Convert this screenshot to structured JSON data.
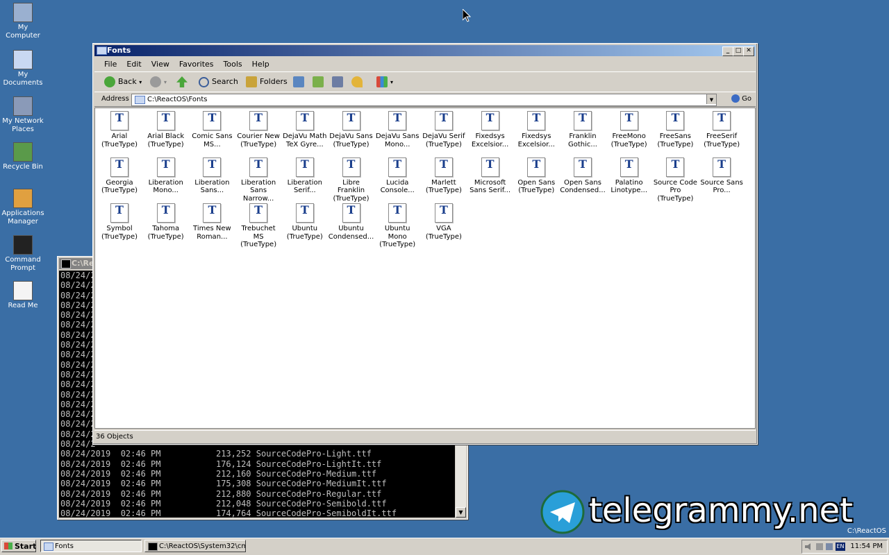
{
  "desktop": {
    "icons": [
      {
        "label": "My Computer",
        "icon": "computer-icon"
      },
      {
        "label": "My Documents",
        "icon": "documents-folder-icon"
      },
      {
        "label": "My Network Places",
        "icon": "network-icon"
      },
      {
        "label": "Recycle Bin",
        "icon": "recycle-bin-icon"
      },
      {
        "label": "Applications Manager",
        "icon": "applications-manager-icon"
      },
      {
        "label": "Command Prompt",
        "icon": "command-prompt-icon"
      },
      {
        "label": "Read Me",
        "icon": "document-icon"
      }
    ]
  },
  "console": {
    "title": "C:\\Reac",
    "lines": [
      "08/24/2",
      "08/24/2",
      "08/24/2",
      "08/24/2",
      "08/24/2",
      "08/24/2",
      "08/24/2",
      "08/24/2",
      "08/24/2",
      "08/24/2",
      "08/24/2",
      "08/24/2",
      "08/24/2",
      "08/24/2",
      "08/24/2",
      "08/24/2",
      "08/24/2",
      "08/24/2",
      "08/24/2019  02:46 PM           213,252 SourceCodePro-Light.ttf",
      "08/24/2019  02:46 PM           176,124 SourceCodePro-LightIt.ttf",
      "08/24/2019  02:46 PM           212,160 SourceCodePro-Medium.ttf",
      "08/24/2019  02:46 PM           175,308 SourceCodePro-MediumIt.ttf",
      "08/24/2019  02:46 PM           212,880 SourceCodePro-Regular.ttf",
      "08/24/2019  02:46 PM           212,048 SourceCodePro-Semibold.ttf",
      "08/24/2019  02:46 PM           174,764 SourceCodePro-SemiboldIt.ttf"
    ]
  },
  "fonts_window": {
    "title": "Fonts",
    "menu": [
      "File",
      "Edit",
      "View",
      "Favorites",
      "Tools",
      "Help"
    ],
    "toolbar": {
      "back": "Back",
      "search": "Search",
      "folders": "Folders"
    },
    "address": {
      "label": "Address",
      "value": "C:\\ReactOS\\Fonts",
      "go": "Go"
    },
    "status": "36 Objects",
    "items": [
      [
        "Arial",
        "(TrueType)"
      ],
      [
        "Arial Black",
        "(TrueType)"
      ],
      [
        "Comic Sans",
        "MS..."
      ],
      [
        "Courier New",
        "(TrueType)"
      ],
      [
        "DejaVu Math",
        "TeX Gyre..."
      ],
      [
        "DejaVu Sans",
        "(TrueType)"
      ],
      [
        "DejaVu Sans",
        "Mono..."
      ],
      [
        "DejaVu Serif",
        "(TrueType)"
      ],
      [
        "Fixedsys",
        "Excelsior..."
      ],
      [
        "Fixedsys",
        "Excelsior..."
      ],
      [
        "Franklin",
        "Gothic..."
      ],
      [
        "FreeMono",
        "(TrueType)"
      ],
      [
        "FreeSans",
        "(TrueType)"
      ],
      [
        "FreeSerif",
        "(TrueType)"
      ],
      [
        "Georgia",
        "(TrueType)"
      ],
      [
        "Liberation",
        "Mono..."
      ],
      [
        "Liberation",
        "Sans..."
      ],
      [
        "Liberation Sans",
        "Narrow..."
      ],
      [
        "Liberation",
        "Serif..."
      ],
      [
        "Libre Franklin",
        "(TrueType)"
      ],
      [
        "Lucida",
        "Console..."
      ],
      [
        "Marlett",
        "(TrueType)"
      ],
      [
        "Microsoft",
        "Sans Serif..."
      ],
      [
        "Open Sans",
        "(TrueType)"
      ],
      [
        "Open Sans",
        "Condensed..."
      ],
      [
        "Palatino",
        "Linotype..."
      ],
      [
        "Source Code",
        "Pro (TrueType)"
      ],
      [
        "Source Sans",
        "Pro..."
      ],
      [
        "Symbol",
        "(TrueType)"
      ],
      [
        "Tahoma",
        "(TrueType)"
      ],
      [
        "Times New",
        "Roman..."
      ],
      [
        "Trebuchet MS",
        "(TrueType)"
      ],
      [
        "Ubuntu",
        "(TrueType)"
      ],
      [
        "Ubuntu",
        "Condensed..."
      ],
      [
        "Ubuntu Mono",
        "(TrueType)"
      ],
      [
        "VGA",
        "(TrueType)"
      ]
    ]
  },
  "taskbar": {
    "start": "Start",
    "tasks": [
      {
        "label": "Fonts",
        "active": true
      },
      {
        "label": "C:\\ReactOS\\System32\\cm...",
        "active": false
      }
    ],
    "lang": "EN",
    "clock": "11:54 PM"
  },
  "corner": {
    "line1": "C:\\ReactOS"
  },
  "watermark": "telegrammy.net",
  "colors": {
    "desktop": "#3a6ea5",
    "title_active": "#0a246a"
  }
}
